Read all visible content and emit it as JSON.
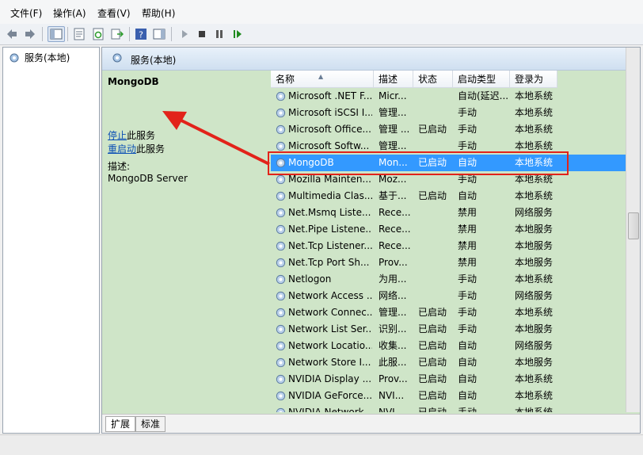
{
  "menu": [
    "文件(F)",
    "操作(A)",
    "查看(V)",
    "帮助(H)"
  ],
  "tree": {
    "root_label": "服务(本地)"
  },
  "pane": {
    "title": "服务(本地)"
  },
  "detail": {
    "service_name": "MongoDB",
    "stop_link": "停止",
    "stop_suffix": "此服务",
    "restart_link": "重启动",
    "restart_suffix": "此服务",
    "desc_label": "描述:",
    "desc_value": "MongoDB Server"
  },
  "columns": [
    "名称",
    "描述",
    "状态",
    "启动类型",
    "登录为"
  ],
  "rows": [
    {
      "name": "Microsoft .NET F...",
      "desc": "Micr...",
      "status": "",
      "startup": "自动(延迟...",
      "logon": "本地系统"
    },
    {
      "name": "Microsoft iSCSI I...",
      "desc": "管理...",
      "status": "",
      "startup": "手动",
      "logon": "本地系统"
    },
    {
      "name": "Microsoft Office...",
      "desc": "管理 ...",
      "status": "已启动",
      "startup": "手动",
      "logon": "本地系统"
    },
    {
      "name": "Microsoft Softw...",
      "desc": "管理...",
      "status": "",
      "startup": "手动",
      "logon": "本地系统"
    },
    {
      "name": "MongoDB",
      "desc": "Mon...",
      "status": "已启动",
      "startup": "自动",
      "logon": "本地系统"
    },
    {
      "name": "Mozilla Mainten...",
      "desc": "Moz...",
      "status": "",
      "startup": "手动",
      "logon": "本地系统"
    },
    {
      "name": "Multimedia Clas...",
      "desc": "基于...",
      "status": "已启动",
      "startup": "自动",
      "logon": "本地系统"
    },
    {
      "name": "Net.Msmq Liste...",
      "desc": "Rece...",
      "status": "",
      "startup": "禁用",
      "logon": "网络服务"
    },
    {
      "name": "Net.Pipe Listene...",
      "desc": "Rece...",
      "status": "",
      "startup": "禁用",
      "logon": "本地服务"
    },
    {
      "name": "Net.Tcp Listener...",
      "desc": "Rece...",
      "status": "",
      "startup": "禁用",
      "logon": "本地服务"
    },
    {
      "name": "Net.Tcp Port Sh...",
      "desc": "Prov...",
      "status": "",
      "startup": "禁用",
      "logon": "本地服务"
    },
    {
      "name": "Netlogon",
      "desc": "为用...",
      "status": "",
      "startup": "手动",
      "logon": "本地系统"
    },
    {
      "name": "Network Access ...",
      "desc": "网络...",
      "status": "",
      "startup": "手动",
      "logon": "网络服务"
    },
    {
      "name": "Network Connec...",
      "desc": "管理...",
      "status": "已启动",
      "startup": "手动",
      "logon": "本地系统"
    },
    {
      "name": "Network List Ser...",
      "desc": "识别...",
      "status": "已启动",
      "startup": "手动",
      "logon": "本地服务"
    },
    {
      "name": "Network Locatio...",
      "desc": "收集...",
      "status": "已启动",
      "startup": "自动",
      "logon": "网络服务"
    },
    {
      "name": "Network Store I...",
      "desc": "此服...",
      "status": "已启动",
      "startup": "自动",
      "logon": "本地服务"
    },
    {
      "name": "NVIDIA Display ...",
      "desc": "Prov...",
      "status": "已启动",
      "startup": "自动",
      "logon": "本地系统"
    },
    {
      "name": "NVIDIA GeForce...",
      "desc": "NVI...",
      "status": "已启动",
      "startup": "自动",
      "logon": "本地系统"
    },
    {
      "name": "NVIDIA Network...",
      "desc": "NVI...",
      "status": "已启动",
      "startup": "手动",
      "logon": "本地系统"
    }
  ],
  "selected_row": 4,
  "tabs": [
    "扩展",
    "标准"
  ],
  "colors": {
    "selection": "#3399ff",
    "annotation": "#e2231a",
    "link": "#0b4fb5",
    "pane_bg": "#cfe5c8"
  }
}
